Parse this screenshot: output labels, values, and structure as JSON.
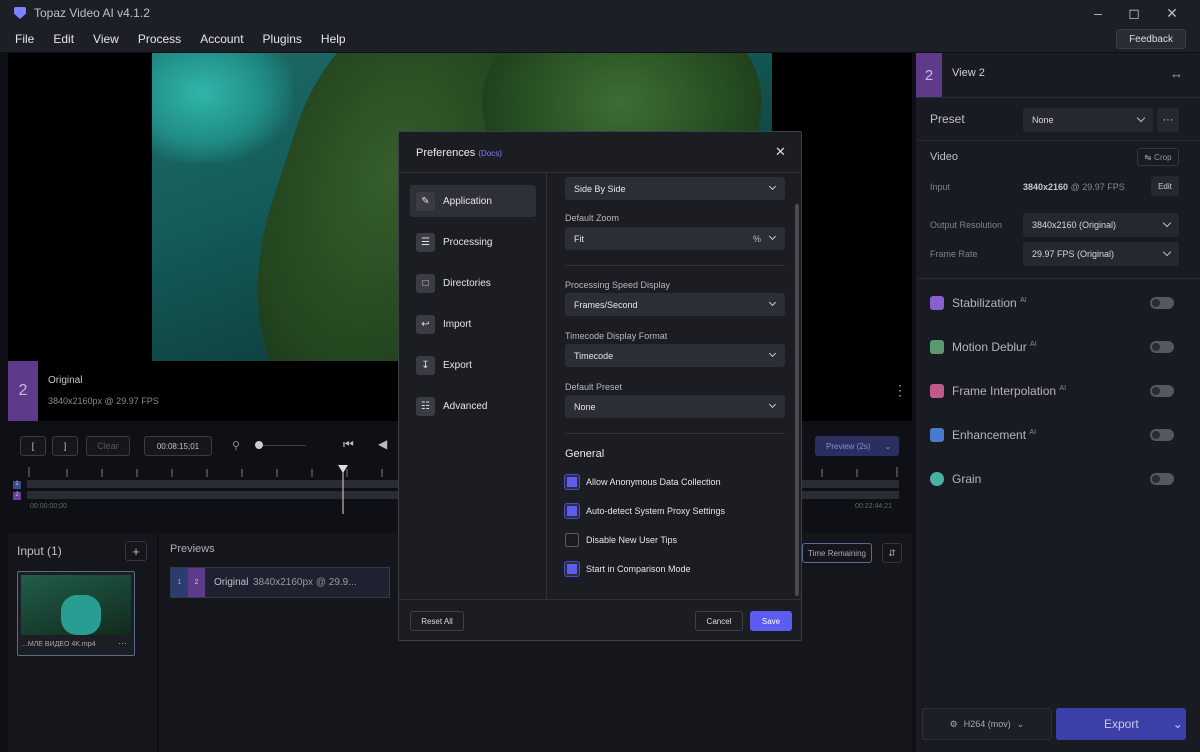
{
  "window": {
    "title": "Topaz Video AI  v4.1.2"
  },
  "menu": {
    "items": [
      "File",
      "Edit",
      "View",
      "Process",
      "Account",
      "Plugins",
      "Help"
    ],
    "feedback": "Feedback"
  },
  "viewer": {
    "view_number": "2",
    "label": "Original",
    "info": "3840x2160px @ 29.97 FPS"
  },
  "right_panel": {
    "view_num": "2",
    "view_title": "View 2",
    "preset_label": "Preset",
    "preset_value": "None",
    "video_label": "Video",
    "crop_label": "Crop",
    "input_label": "Input",
    "input_value_res": "3840x2160",
    "input_value_fps": "@ 29.97 FPS",
    "edit_label": "Edit",
    "output_res_label": "Output Resolution",
    "output_res_value": "3840x2160 (Original)",
    "frame_rate_label": "Frame Rate",
    "frame_rate_value": "29.97 FPS (Original)",
    "features": [
      {
        "name": "Stabilization",
        "ai": "AI",
        "color": "#8a5fd0"
      },
      {
        "name": "Motion Deblur",
        "ai": "AI",
        "color": "#5a9a6e"
      },
      {
        "name": "Frame Interpolation",
        "ai": "AI",
        "color": "#c05a8a"
      },
      {
        "name": "Enhancement",
        "ai": "AI",
        "color": "#4a7ad0"
      },
      {
        "name": "Grain",
        "ai": "",
        "color": "#4ab0a0"
      }
    ],
    "codec": "H264 (mov)",
    "export_label": "Export"
  },
  "timeline": {
    "in_mark": "[",
    "out_mark": "]",
    "clear": "Clear",
    "timecode": "00:08:15;01",
    "preview_btn": "Preview (2s)",
    "start_tc": "00:00:00;00",
    "end_tc": "00:22:44;21",
    "track1": "1",
    "track2": "2"
  },
  "bottom": {
    "input_title": "Input (1)",
    "add": "+",
    "clip_name": "...МЛЕ ВИДЕО 4K.mp4",
    "clip_more": "···",
    "previews_title": "Previews",
    "preview_item": {
      "a": "1",
      "b": "2",
      "label": "Original",
      "info": "3840x2160px @ 29.9..."
    },
    "time_remaining": "Time Remaining"
  },
  "preferences": {
    "title": "Preferences",
    "docs": "(Docs)",
    "nav": [
      "Application",
      "Processing",
      "Directories",
      "Import",
      "Export",
      "Advanced"
    ],
    "compare_value": "Side By Side",
    "default_zoom_label": "Default Zoom",
    "default_zoom_value": "Fit",
    "zoom_unit": "%",
    "speed_label": "Processing Speed Display",
    "speed_value": "Frames/Second",
    "timecode_label": "Timecode Display Format",
    "timecode_value": "Timecode",
    "preset_label": "Default Preset",
    "preset_value": "None",
    "general_title": "General",
    "checks": [
      {
        "label": "Allow Anonymous Data Collection",
        "checked": true
      },
      {
        "label": "Auto-detect System Proxy Settings",
        "checked": true
      },
      {
        "label": "Disable New User Tips",
        "checked": false
      },
      {
        "label": "Start in Comparison Mode",
        "checked": true
      }
    ],
    "reset_all": "Reset All",
    "cancel": "Cancel",
    "save": "Save"
  }
}
